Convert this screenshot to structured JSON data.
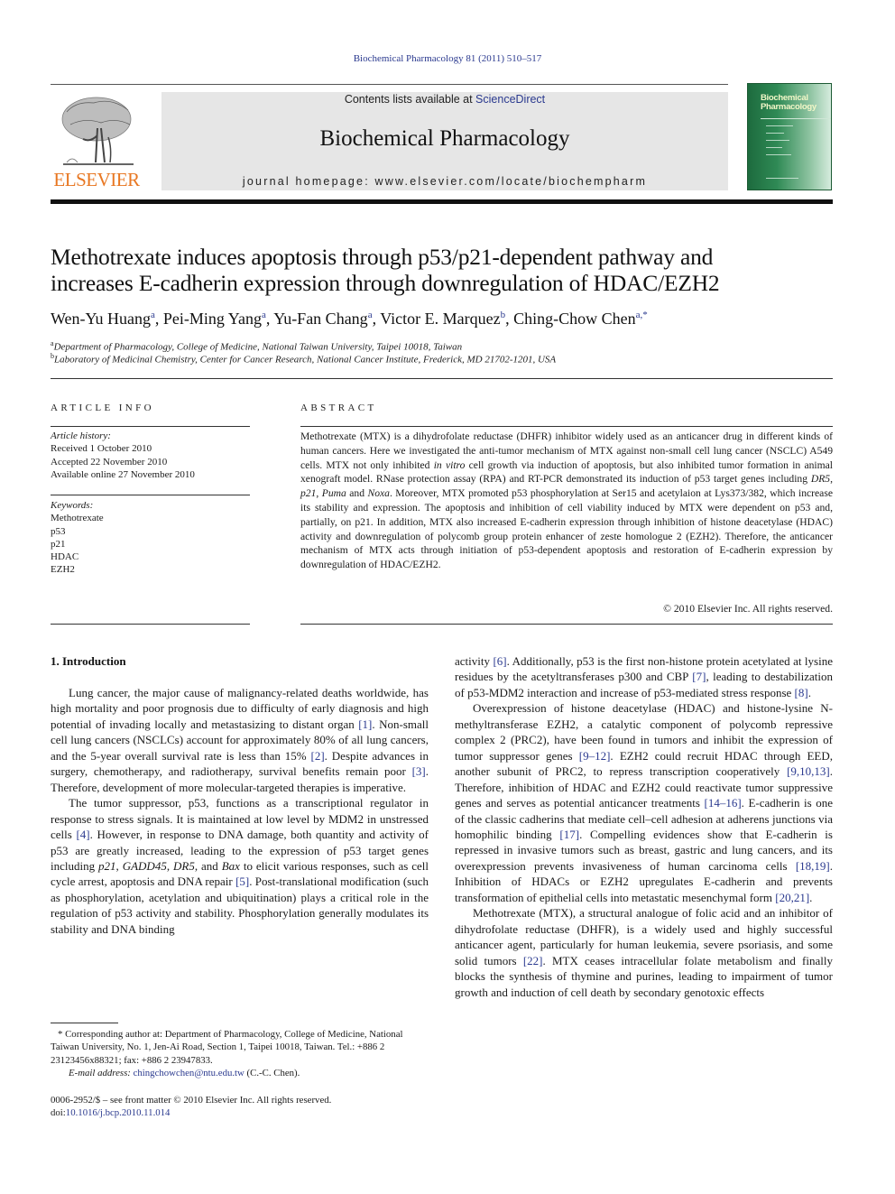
{
  "header": {
    "journal_reference": "Biochemical Pharmacology 81 (2011) 510–517",
    "publisher_logo_text": "ELSEVIER",
    "contents_prefix": "Contents lists available at ",
    "contents_link": "ScienceDirect",
    "journal_title": "Biochemical Pharmacology",
    "homepage": "journal homepage: www.elsevier.com/locate/biochempharm",
    "cover_title_line1": "Biochemical",
    "cover_title_line2": "Pharmacology"
  },
  "article": {
    "title_line1": "Methotrexate induces apoptosis through p53/p21-dependent pathway and",
    "title_line2": "increases E-cadherin expression through downregulation of HDAC/EZH2",
    "authors": [
      {
        "name": "Wen-Yu Huang",
        "aff": "a"
      },
      {
        "name": "Pei-Ming Yang",
        "aff": "a"
      },
      {
        "name": "Yu-Fan Chang",
        "aff": "a"
      },
      {
        "name": "Victor E. Marquez",
        "aff": "b"
      },
      {
        "name": "Ching-Chow Chen",
        "aff": "a,*"
      }
    ],
    "affiliations": [
      {
        "mark": "a",
        "text": "Department of Pharmacology, College of Medicine, National Taiwan University, Taipei 10018, Taiwan"
      },
      {
        "mark": "b",
        "text": "Laboratory of Medicinal Chemistry, Center for Cancer Research, National Cancer Institute, Frederick, MD 21702-1201, USA"
      }
    ]
  },
  "article_info": {
    "heading": "ARTICLE INFO",
    "history_label": "Article history:",
    "received": "Received 1 October 2010",
    "accepted": "Accepted 22 November 2010",
    "online": "Available online 27 November 2010",
    "keywords_label": "Keywords:",
    "keywords": [
      "Methotrexate",
      "p53",
      "p21",
      "HDAC",
      "EZH2"
    ]
  },
  "abstract": {
    "heading": "ABSTRACT",
    "part1": "Methotrexate (MTX) is a dihydrofolate reductase (DHFR) inhibitor widely used as an anticancer drug in different kinds of human cancers. Here we investigated the anti-tumor mechanism of MTX against non-small cell lung cancer (NSCLC) A549 cells. MTX not only inhibited ",
    "italic1": "in vitro",
    "part2": " cell growth via induction of apoptosis, but also inhibited tumor formation in animal xenograft model. RNase protection assay (RPA) and RT-PCR demonstrated its induction of p53 target genes including ",
    "gene1": "DR5",
    "sep1": ", ",
    "gene2": "p21",
    "sep2": ", ",
    "gene3": "Puma",
    "sep3": " and ",
    "gene4": "Noxa",
    "part3": ". Moreover, MTX promoted p53 phosphorylation at Ser15 and acetylaion at Lys373/382, which increase its stability and expression. The apoptosis and inhibition of cell viability induced by MTX were dependent on p53 and, partially, on p21. In addition, MTX also increased E-cadherin expression through inhibition of histone deacetylase (HDAC) activity and downregulation of polycomb group protein enhancer of zeste homologue 2 (EZH2). Therefore, the anticancer mechanism of MTX acts through initiation of p53-dependent apoptosis and restoration of E-cadherin expression by downregulation of HDAC/EZH2.",
    "copyright": "© 2010 Elsevier Inc. All rights reserved."
  },
  "introduction": {
    "heading": "1.  Introduction",
    "p1": {
      "a": "Lung cancer, the major cause of malignancy-related deaths worldwide, has high mortality and poor prognosis due to difficulty of early diagnosis and high potential of invading locally and metastasizing to distant organ ",
      "r1": "[1]",
      "b": ". Non-small cell lung cancers (NSCLCs) account for approximately 80% of all lung cancers, and the 5-year overall survival rate is less than 15% ",
      "r2": "[2]",
      "c": ". Despite advances in surgery, chemotherapy, and radiotherapy, survival benefits remain poor ",
      "r3": "[3]",
      "d": ". Therefore, development of more molecular-targeted therapies is imperative."
    },
    "p2": {
      "a": "The tumor suppressor, p53, functions as a transcriptional regulator in response to stress signals. It is maintained at low level by MDM2 in unstressed cells ",
      "r4": "[4]",
      "b": ". However, in response to DNA damage, both quantity and activity of p53 are greatly increased, leading to the expression of p53 target genes including ",
      "g1": "p21",
      "s1": ", ",
      "g2": "GADD45",
      "s2": ", ",
      "g3": "DR5",
      "s3": ", and ",
      "g4": "Bax",
      "c": " to elicit various responses, such as cell cycle arrest, apoptosis and DNA repair ",
      "r5": "[5]",
      "d": ". Post-translational modification (such as phosphorylation, acetylation and ubiquitination) plays a critical role in the regulation of p53 activity and stability. Phosphorylation generally modulates its stability and DNA binding"
    },
    "p2_cont": {
      "a": "activity ",
      "r6": "[6]",
      "b": ". Additionally, p53 is the first non-histone protein acetylated at lysine residues by the acetyltransferases p300 and CBP ",
      "r7": "[7]",
      "c": ", leading to destabilization of p53-MDM2 interaction and increase of p53-mediated stress response ",
      "r8": "[8]",
      "d": "."
    },
    "p3": {
      "a": "Overexpression of histone deacetylase (HDAC) and histone-lysine N-methyltransferase EZH2, a catalytic component of polycomb repressive complex 2 (PRC2), have been found in tumors and inhibit the expression of tumor suppressor genes ",
      "r1": "[9–12]",
      "b": ". EZH2 could recruit HDAC through EED, another subunit of PRC2, to repress transcription cooperatively ",
      "r2": "[9,10,13]",
      "c": ". Therefore, inhibition of HDAC and EZH2 could reactivate tumor suppressive genes and serves as potential anticancer treatments ",
      "r3": "[14–16]",
      "d": ". E-cadherin is one of the classic cadherins that mediate cell–cell adhesion at adherens junctions via homophilic binding ",
      "r4": "[17]",
      "e": ". Compelling evidences show that E-cadherin is repressed in invasive tumors such as breast, gastric and lung cancers, and its overexpression prevents invasiveness of human carcinoma cells ",
      "r5": "[18,19]",
      "f": ". Inhibition of HDACs or EZH2 upregulates E-cadherin and prevents transformation of epithelial cells into metastatic mesenchymal form ",
      "r6": "[20,21]",
      "g": "."
    },
    "p4": {
      "a": "Methotrexate (MTX), a structural analogue of folic acid and an inhibitor of dihydrofolate reductase (DHFR), is a widely used and highly successful anticancer agent, particularly for human leukemia, severe psoriasis, and some solid tumors ",
      "r1": "[22]",
      "b": ". MTX ceases intracellular folate metabolism and finally blocks the synthesis of thymine and purines, leading to impairment of tumor growth and induction of cell death by secondary genotoxic effects"
    }
  },
  "footnote": {
    "corresponding": "* Corresponding author at: Department of Pharmacology, College of Medicine, National Taiwan University, No. 1, Jen-Ai Road, Section 1, Taipei 10018, Taiwan. Tel.: +886 2 23123456x88321; fax: +886 2 23947833.",
    "email_label": "E-mail address: ",
    "email": "chingchowchen@ntu.edu.tw",
    "email_suffix": " (C.-C. Chen).",
    "issn_line": "0006-2952/$ – see front matter © 2010 Elsevier Inc. All rights reserved.",
    "doi_label": "doi:",
    "doi": "10.1016/j.bcp.2010.11.014"
  },
  "colors": {
    "link": "#2b3a8f",
    "elsevier_orange": "#e87722",
    "header_box": "#e6e6e6",
    "cover_green": "#1d6b3e"
  }
}
